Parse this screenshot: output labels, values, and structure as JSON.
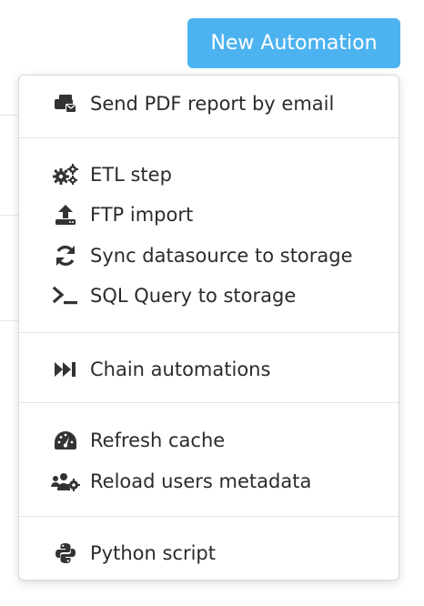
{
  "header": {
    "new_automation_label": "New Automation"
  },
  "menu": {
    "groups": [
      {
        "items": [
          {
            "label": "Send PDF report by email",
            "icon": "email-report-icon"
          }
        ]
      },
      {
        "items": [
          {
            "label": "ETL step",
            "icon": "cogs-icon"
          },
          {
            "label": "FTP import",
            "icon": "upload-icon"
          },
          {
            "label": "Sync datasource to storage",
            "icon": "sync-icon"
          },
          {
            "label": "SQL Query to storage",
            "icon": "terminal-icon"
          }
        ]
      },
      {
        "items": [
          {
            "label": "Chain automations",
            "icon": "fast-forward-icon"
          }
        ]
      },
      {
        "items": [
          {
            "label": "Refresh cache",
            "icon": "gauge-icon"
          },
          {
            "label": "Reload users metadata",
            "icon": "users-cog-icon"
          }
        ]
      },
      {
        "items": [
          {
            "label": "Python script",
            "icon": "python-icon"
          }
        ]
      }
    ]
  },
  "colors": {
    "button_bg": "#4db3f0",
    "button_text": "#ffffff",
    "text": "#2b2b2b",
    "icon": "#333333",
    "divider": "#e3e3e3"
  }
}
